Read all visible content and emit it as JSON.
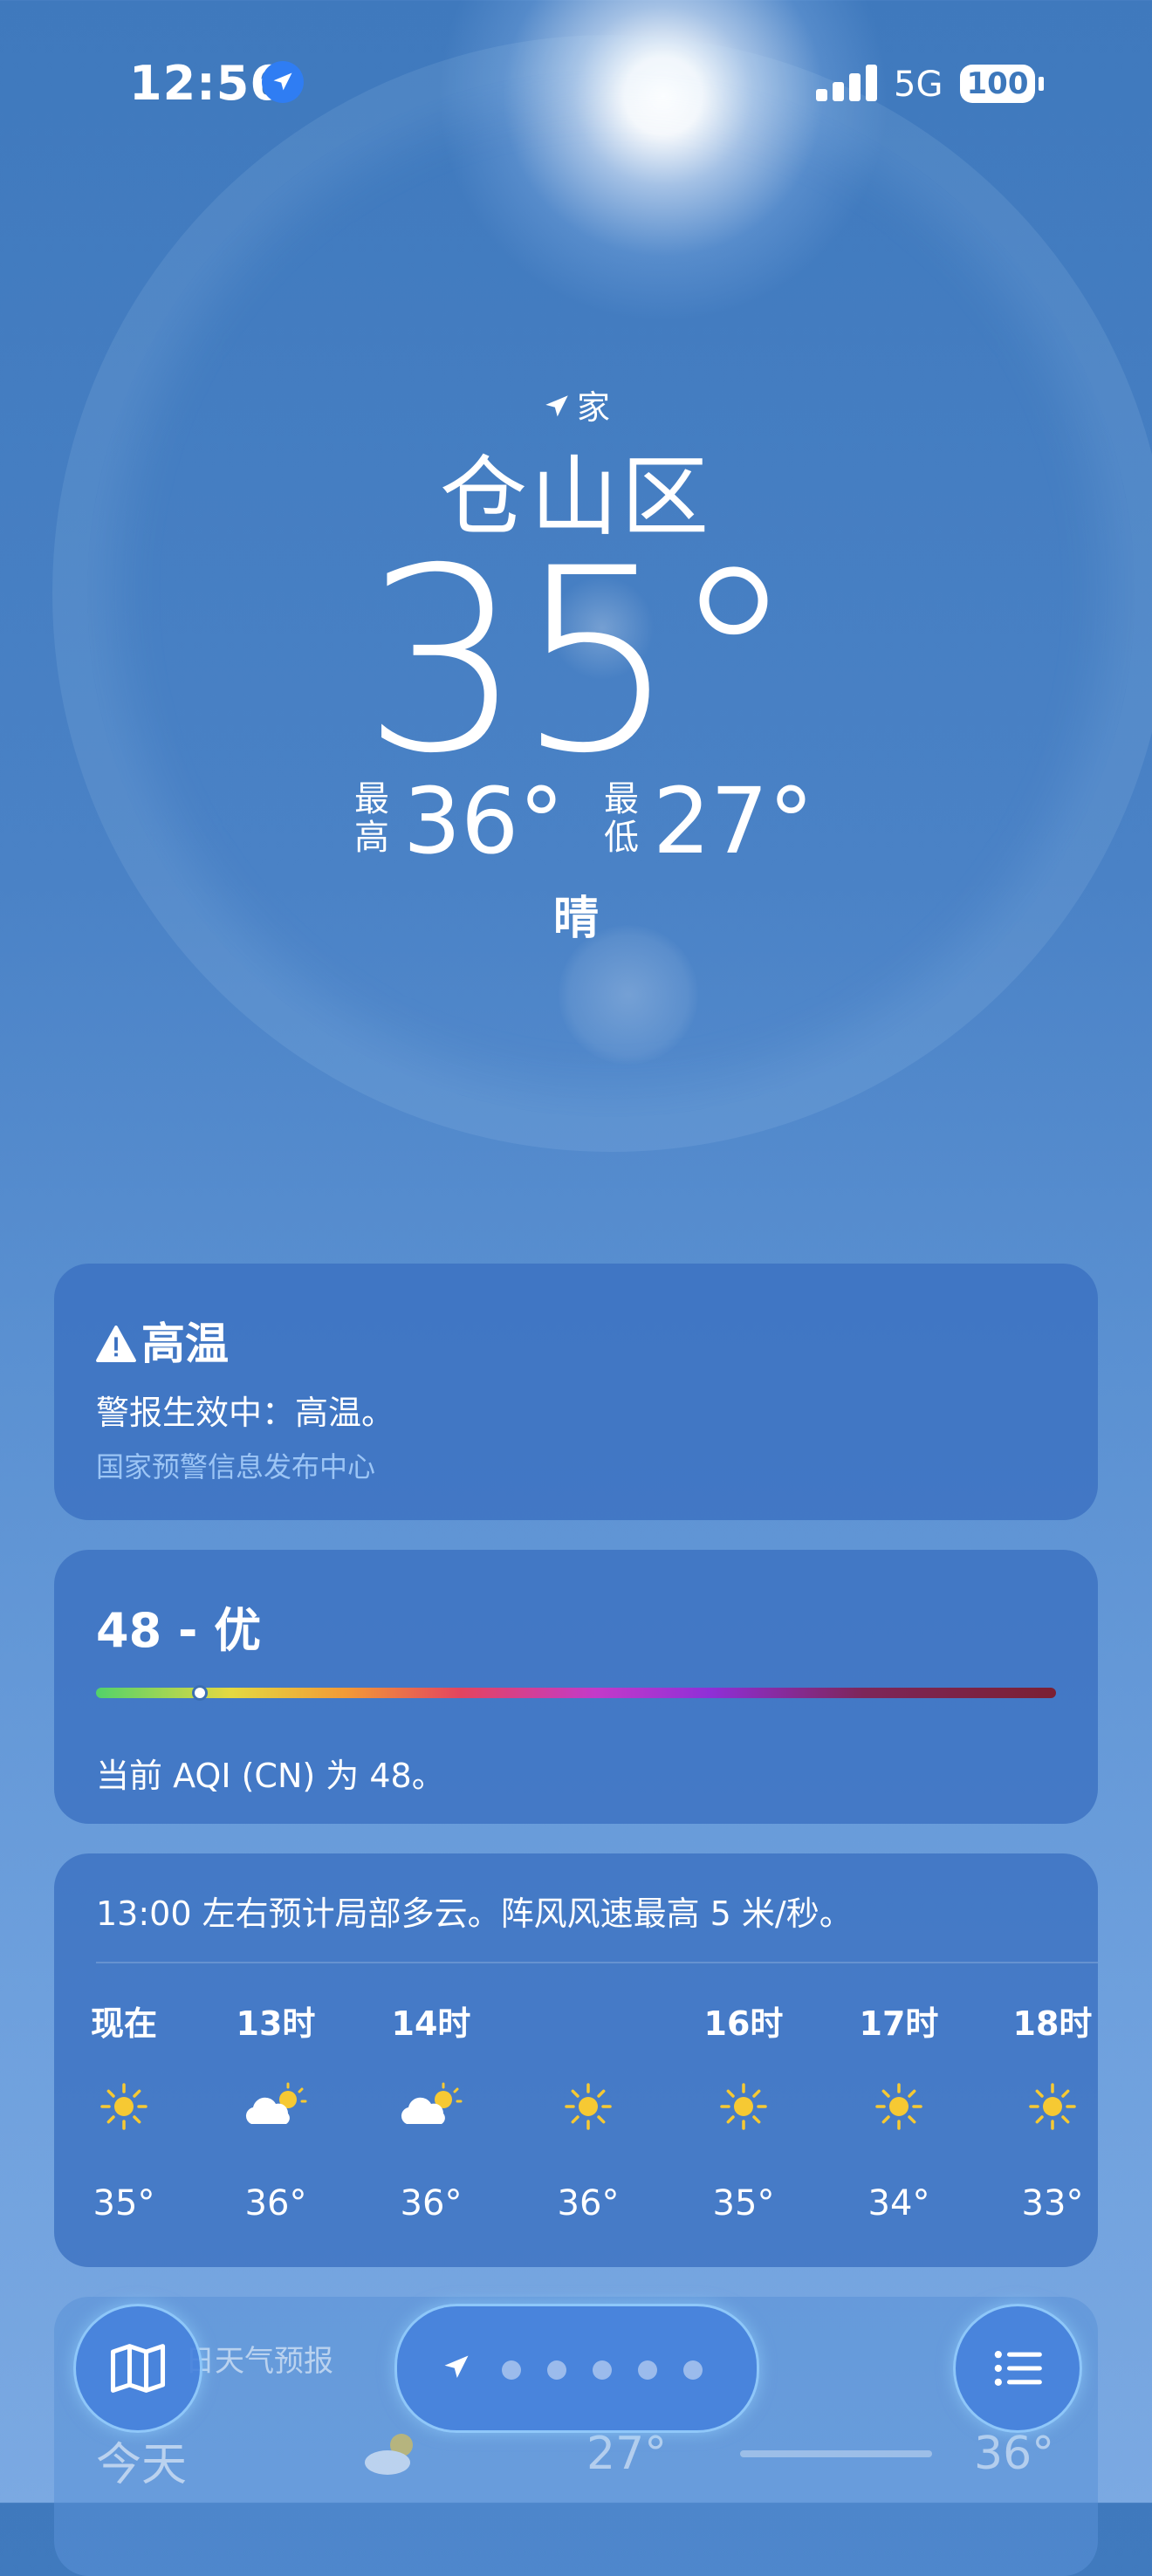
{
  "status_bar": {
    "time": "12:56",
    "network": "5G",
    "battery": "100"
  },
  "location": {
    "home_label": "家",
    "city": "仓山区"
  },
  "current": {
    "temperature": "35°",
    "high_label": "最高",
    "high": "36°",
    "low_label": "最低",
    "low": "27°",
    "condition": "晴"
  },
  "alert": {
    "title": "高温",
    "body": "警报生效中：高温。",
    "source": "国家预警信息发布中心"
  },
  "aqi": {
    "title": "48 - 优",
    "description": "当前 AQI (CN) 为 48。",
    "indicator_fraction": 0.1
  },
  "hourly": {
    "summary": "13:00 左右预计局部多云。阵风风速最高 5 米/秒。",
    "items": [
      {
        "label": "现在",
        "icon": "sun-icon",
        "temp": "35°"
      },
      {
        "label": "13时",
        "icon": "partly-cloudy-icon",
        "temp": "36°"
      },
      {
        "label": "14时",
        "icon": "partly-cloudy-icon",
        "temp": "36°"
      },
      {
        "label": "",
        "icon": "sun-icon",
        "temp": "36°"
      },
      {
        "label": "16时",
        "icon": "sun-icon",
        "temp": "35°"
      },
      {
        "label": "17时",
        "icon": "sun-icon",
        "temp": "34°"
      },
      {
        "label": "18时",
        "icon": "sun-icon",
        "temp": "33°"
      }
    ]
  },
  "daily": {
    "title": "日天气预报",
    "today_label": "今天",
    "today_low": "27°",
    "today_high": "36°"
  },
  "colors": {
    "accent_blue": "#2f7df3",
    "card_bg": "#3a70c0",
    "sun_yellow": "#f6c933"
  }
}
